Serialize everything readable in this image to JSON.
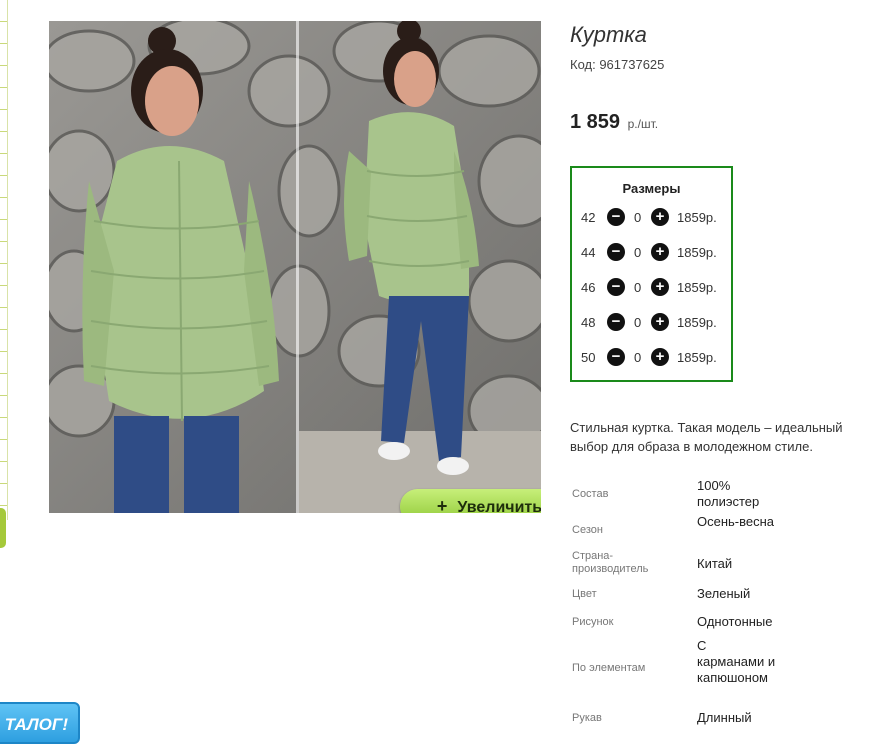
{
  "catalog_button": "ТАЛОГ!",
  "product": {
    "title": "Куртка",
    "code": "Код: 961737625",
    "price": "1 859",
    "price_unit": "р./шт."
  },
  "zoom_label": "Увеличить",
  "sizes": {
    "title": "Размеры",
    "rows": [
      {
        "size": "42",
        "qty": "0",
        "price": "1859р."
      },
      {
        "size": "44",
        "qty": "0",
        "price": "1859р."
      },
      {
        "size": "46",
        "qty": "0",
        "price": "1859р."
      },
      {
        "size": "48",
        "qty": "0",
        "price": "1859р."
      },
      {
        "size": "50",
        "qty": "0",
        "price": "1859р."
      }
    ]
  },
  "description": "Стильная куртка. Такая модель – идеальный выбор для образа в молодежном стиле.",
  "properties": [
    {
      "key": "Состав",
      "value": "100% полиэстер"
    },
    {
      "key": "Сезон",
      "value": "Осень-весна"
    },
    {
      "key": "Страна-производитель",
      "value": "Китай"
    },
    {
      "key": "Цвет",
      "value": "Зеленый"
    },
    {
      "key": "Рисунок",
      "value": "Однотонные"
    },
    {
      "key": "По элементам",
      "value": "С карманами и капюшоном"
    },
    {
      "key": "Рукав",
      "value": "Длинный"
    }
  ]
}
